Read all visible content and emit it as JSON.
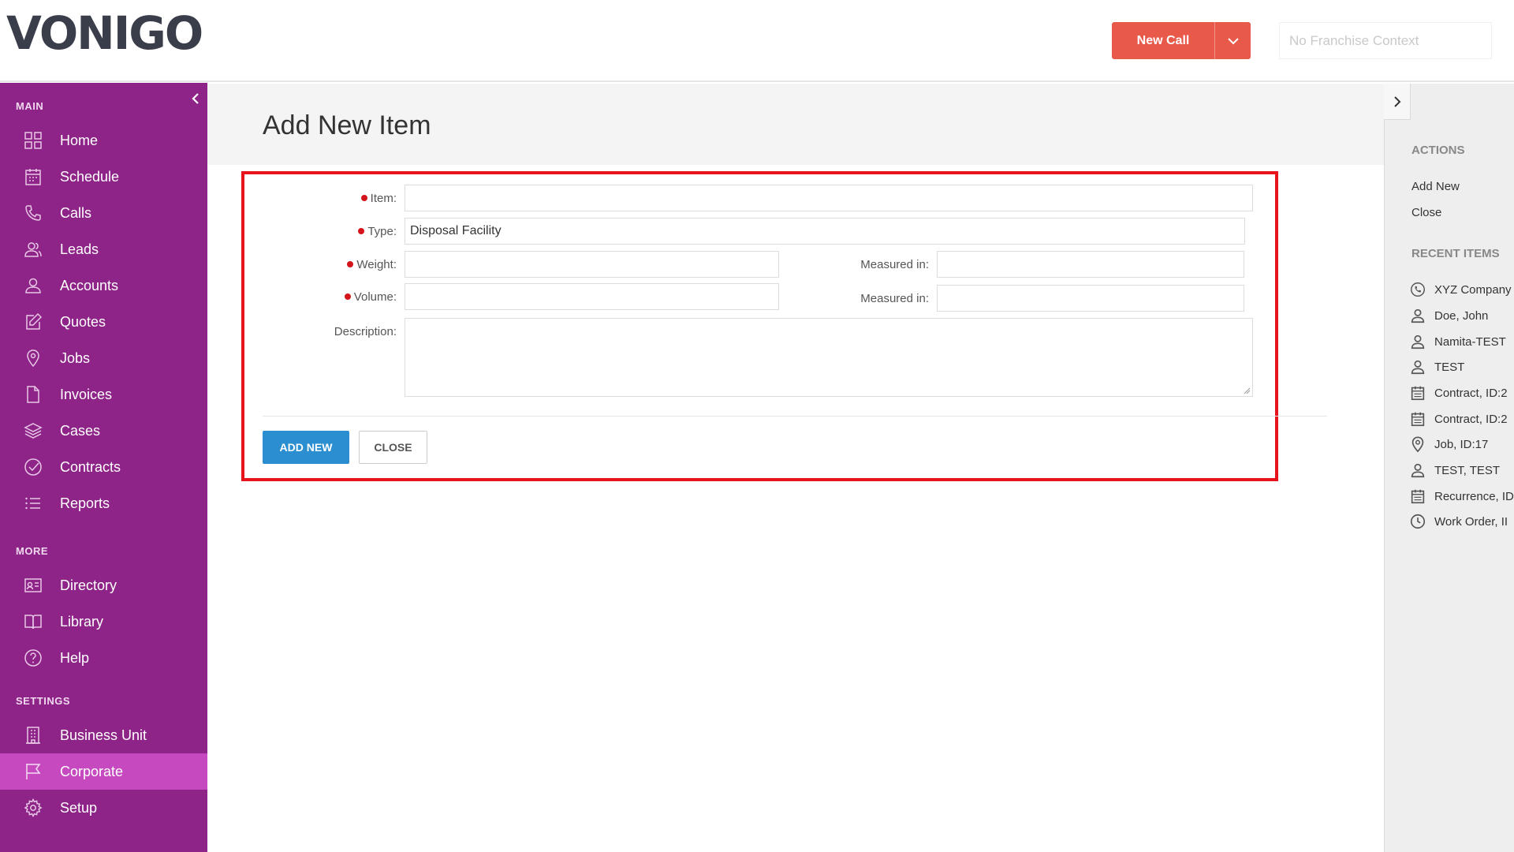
{
  "brand": {
    "logo": "VONIGO"
  },
  "header": {
    "new_call_label": "New Call",
    "franchise_placeholder": "No Franchise Context"
  },
  "sidebar": {
    "sections": {
      "main": "MAIN",
      "more": "MORE",
      "settings": "SETTINGS"
    },
    "main_items": [
      {
        "label": "Home",
        "icon": "grid-icon"
      },
      {
        "label": "Schedule",
        "icon": "calendar-icon"
      },
      {
        "label": "Calls",
        "icon": "phone-icon"
      },
      {
        "label": "Leads",
        "icon": "users-icon"
      },
      {
        "label": "Accounts",
        "icon": "user-icon"
      },
      {
        "label": "Quotes",
        "icon": "edit-icon"
      },
      {
        "label": "Jobs",
        "icon": "map-pin-icon"
      },
      {
        "label": "Invoices",
        "icon": "file-icon"
      },
      {
        "label": "Cases",
        "icon": "layers-icon"
      },
      {
        "label": "Contracts",
        "icon": "check-circle-icon"
      },
      {
        "label": "Reports",
        "icon": "list-icon"
      }
    ],
    "more_items": [
      {
        "label": "Directory",
        "icon": "contact-card-icon"
      },
      {
        "label": "Library",
        "icon": "book-icon"
      },
      {
        "label": "Help",
        "icon": "help-circle-icon"
      }
    ],
    "settings_items": [
      {
        "label": "Business Unit",
        "icon": "building-icon"
      },
      {
        "label": "Corporate",
        "icon": "flag-icon",
        "active": true
      },
      {
        "label": "Setup",
        "icon": "gear-icon"
      }
    ],
    "active_color": "#c649c0",
    "bg_color": "#8e2388"
  },
  "page": {
    "title": "Add New Item"
  },
  "form": {
    "item_label": "Item:",
    "item_value": "",
    "type_label": "Type:",
    "type_value": "Disposal Facility",
    "weight_label": "Weight:",
    "weight_value": "",
    "weight_measured_label": "Measured in:",
    "weight_measured_value": "",
    "volume_label": "Volume:",
    "volume_value": "",
    "volume_measured_label": "Measured in:",
    "volume_measured_value": "",
    "description_label": "Description:",
    "description_value": "",
    "add_new_button": "ADD NEW",
    "close_button": "CLOSE"
  },
  "right_panel": {
    "actions_heading": "ACTIONS",
    "actions": [
      "Add New",
      "Close"
    ],
    "recent_heading": "RECENT ITEMS",
    "recent_items": [
      {
        "label": "XYZ Company",
        "icon": "phone-history-icon"
      },
      {
        "label": "Doe, John",
        "icon": "user-icon"
      },
      {
        "label": "Namita-TEST",
        "icon": "user-icon"
      },
      {
        "label": "TEST",
        "icon": "user-icon"
      },
      {
        "label": "Contract, ID:2",
        "icon": "calendar-icon"
      },
      {
        "label": "Contract, ID:2",
        "icon": "calendar-icon"
      },
      {
        "label": "Job, ID:17",
        "icon": "map-pin-icon"
      },
      {
        "label": "TEST, TEST",
        "icon": "user-icon"
      },
      {
        "label": "Recurrence, ID",
        "icon": "calendar-icon"
      },
      {
        "label": "Work Order, II",
        "icon": "clock-icon"
      }
    ]
  },
  "colors": {
    "accent_red": "#e8594a",
    "primary_blue": "#2a8ed1",
    "highlight_frame": "#e8141b",
    "required_dot": "#d3141b"
  }
}
